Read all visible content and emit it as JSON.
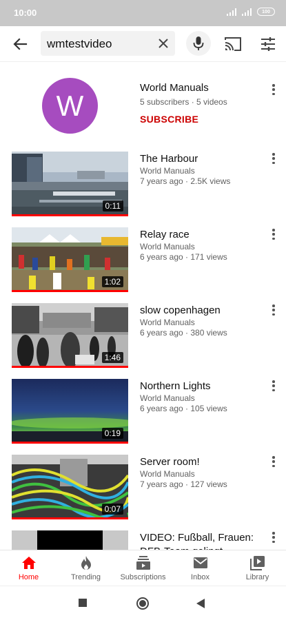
{
  "status_bar": {
    "time": "10:00",
    "battery": "100"
  },
  "search": {
    "query": "wmtestvideo"
  },
  "colors": {
    "accent": "#ff0000",
    "subscribe": "#cc0000",
    "avatar": "#a64cbf"
  },
  "channel": {
    "avatar_letter": "W",
    "name": "World Manuals",
    "meta": "5 subscribers · 5 videos",
    "subscribe_label": "SUBSCRIBE"
  },
  "videos": [
    {
      "title": "The Harbour",
      "channel": "World Manuals",
      "meta": "7 years ago · 2.5K views",
      "duration": "0:11"
    },
    {
      "title": "Relay race",
      "channel": "World Manuals",
      "meta": "6 years ago · 171 views",
      "duration": "1:02"
    },
    {
      "title": "slow copenhagen",
      "channel": "World Manuals",
      "meta": "6 years ago · 380 views",
      "duration": "1:46"
    },
    {
      "title": "Northern Lights",
      "channel": "World Manuals",
      "meta": "6 years ago · 105 views",
      "duration": "0:19"
    },
    {
      "title": "Server room!",
      "channel": "World Manuals",
      "meta": "7 years ago · 127 views",
      "duration": "0:07"
    },
    {
      "title": "VIDEO: Fußball, Frauen: DFB-Team gelingt"
    }
  ],
  "bottom_nav": [
    {
      "label": "Home",
      "icon": "home-icon",
      "active": true
    },
    {
      "label": "Trending",
      "icon": "flame-icon"
    },
    {
      "label": "Subscriptions",
      "icon": "subscriptions-icon"
    },
    {
      "label": "Inbox",
      "icon": "mail-icon"
    },
    {
      "label": "Library",
      "icon": "library-icon"
    }
  ],
  "icons": [
    "back-arrow-icon",
    "clear-icon",
    "mic-icon",
    "cast-icon",
    "filter-icon",
    "more-vert-icon",
    "stop-icon",
    "home-circle-icon",
    "back-triangle-icon"
  ]
}
